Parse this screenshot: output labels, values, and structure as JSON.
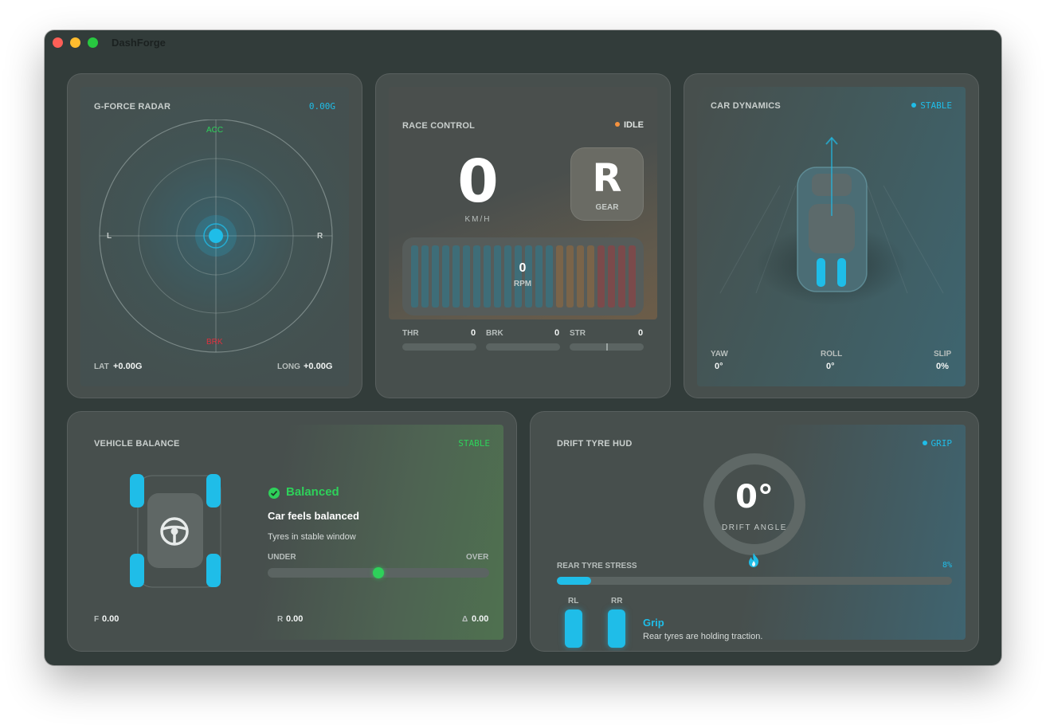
{
  "window": {
    "title": "DashForge"
  },
  "colors": {
    "accent_cyan": "#1fbde8",
    "ok_green": "#2ed15a",
    "brake_red": "#e0303e",
    "idle_orange": "#f5923e",
    "panel_bg": "#474f4d",
    "window_bg": "#323c3a"
  },
  "gforce": {
    "title": "G-FORCE RADAR",
    "total": "0.00G",
    "label_acc": "ACC",
    "label_brk": "BRK",
    "label_left": "L",
    "label_right": "R",
    "lat_label": "LAT",
    "lat_value": "+0.00G",
    "long_label": "LONG",
    "long_value": "+0.00G"
  },
  "race": {
    "title": "RACE CONTROL",
    "status": "IDLE",
    "speed": "0",
    "speed_unit": "KM/H",
    "gear": "R",
    "gear_label": "GEAR",
    "rpm_value": "0",
    "rpm_label": "RPM",
    "throttle_label": "THR",
    "throttle_value": "0",
    "brake_label": "BRK",
    "brake_value": "0",
    "steer_label": "STR",
    "steer_value": "0"
  },
  "dynamics": {
    "title": "CAR DYNAMICS",
    "status": "STABLE",
    "yaw_label": "YAW",
    "yaw_value": "0°",
    "roll_label": "ROLL",
    "roll_value": "0°",
    "slip_label": "SLIP",
    "slip_value": "0%"
  },
  "balance": {
    "title": "VEHICLE BALANCE",
    "status": "STABLE",
    "state": "Balanced",
    "headline": "Car feels balanced",
    "description": "Tyres in stable window",
    "under_label": "UNDER",
    "over_label": "OVER",
    "balance_position": 0.5,
    "front_label": "F",
    "front_value": "0.00",
    "rear_label": "R",
    "rear_value": "0.00",
    "delta_label": "Δ",
    "delta_value": "0.00",
    "icons": {
      "check": "check-circle-icon",
      "wheel": "steering-wheel-icon"
    }
  },
  "drift": {
    "title": "DRIFT TYRE HUD",
    "status": "GRIP",
    "angle": "0°",
    "angle_label": "DRIFT ANGLE",
    "stress_label": "REAR TYRE STRESS",
    "stress_value": "8%",
    "stress_fraction": 0.08,
    "rl_label": "RL",
    "rr_label": "RR",
    "grip_title": "Grip",
    "grip_description": "Rear tyres are holding traction.",
    "icons": {
      "flame": "flame-icon"
    }
  }
}
